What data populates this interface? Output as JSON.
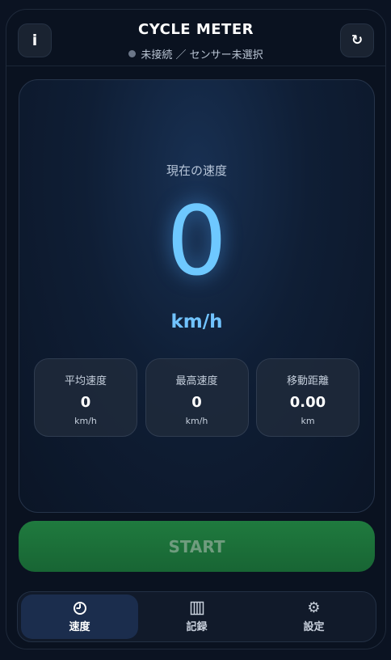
{
  "header": {
    "title": "CYCLE METER",
    "status_text": "未接続 ／ センサー未選択",
    "info_label": "i",
    "reset_label": "↻"
  },
  "speed": {
    "label": "現在の速度",
    "value": "0",
    "unit": "km/h"
  },
  "stats": [
    {
      "label": "平均速度",
      "value": "0",
      "unit": "km/h"
    },
    {
      "label": "最高速度",
      "value": "0",
      "unit": "km/h"
    },
    {
      "label": "移動距離",
      "value": "0.00",
      "unit": "km"
    }
  ],
  "start_label": "START",
  "nav": {
    "items": [
      {
        "label": "速度",
        "icon": "gauge-icon",
        "active": true
      },
      {
        "label": "記録",
        "icon": "records-icon",
        "active": false
      },
      {
        "label": "設定",
        "icon": "gear-icon",
        "active": false
      }
    ]
  },
  "colors": {
    "accent": "#6ec8ff",
    "start": "#1f7a3e",
    "nav_active": "#1b2d4d"
  }
}
